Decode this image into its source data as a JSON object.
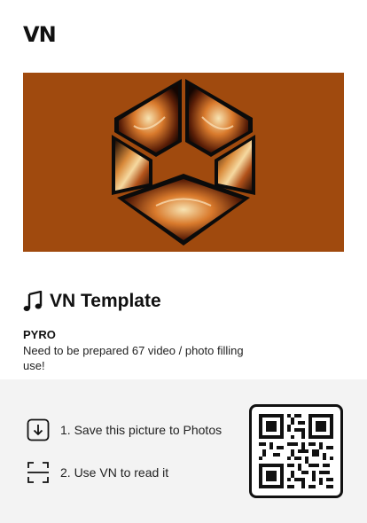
{
  "brand": {
    "logo_text": "VN"
  },
  "hero": {
    "image_description": "orange-background kaleidoscope hexagon artwork",
    "background_color": "#a04a0e"
  },
  "template": {
    "heading": "VN Template",
    "name": "PYRO",
    "description": "Need to be prepared 67 video / photo filling use!"
  },
  "steps": [
    {
      "label": "1. Save this picture to Photos",
      "icon": "download-icon"
    },
    {
      "label": "2. Use VN to read it",
      "icon": "scan-icon"
    }
  ],
  "colors": {
    "bottom_panel": "#f3f3f3",
    "text": "#111111"
  }
}
